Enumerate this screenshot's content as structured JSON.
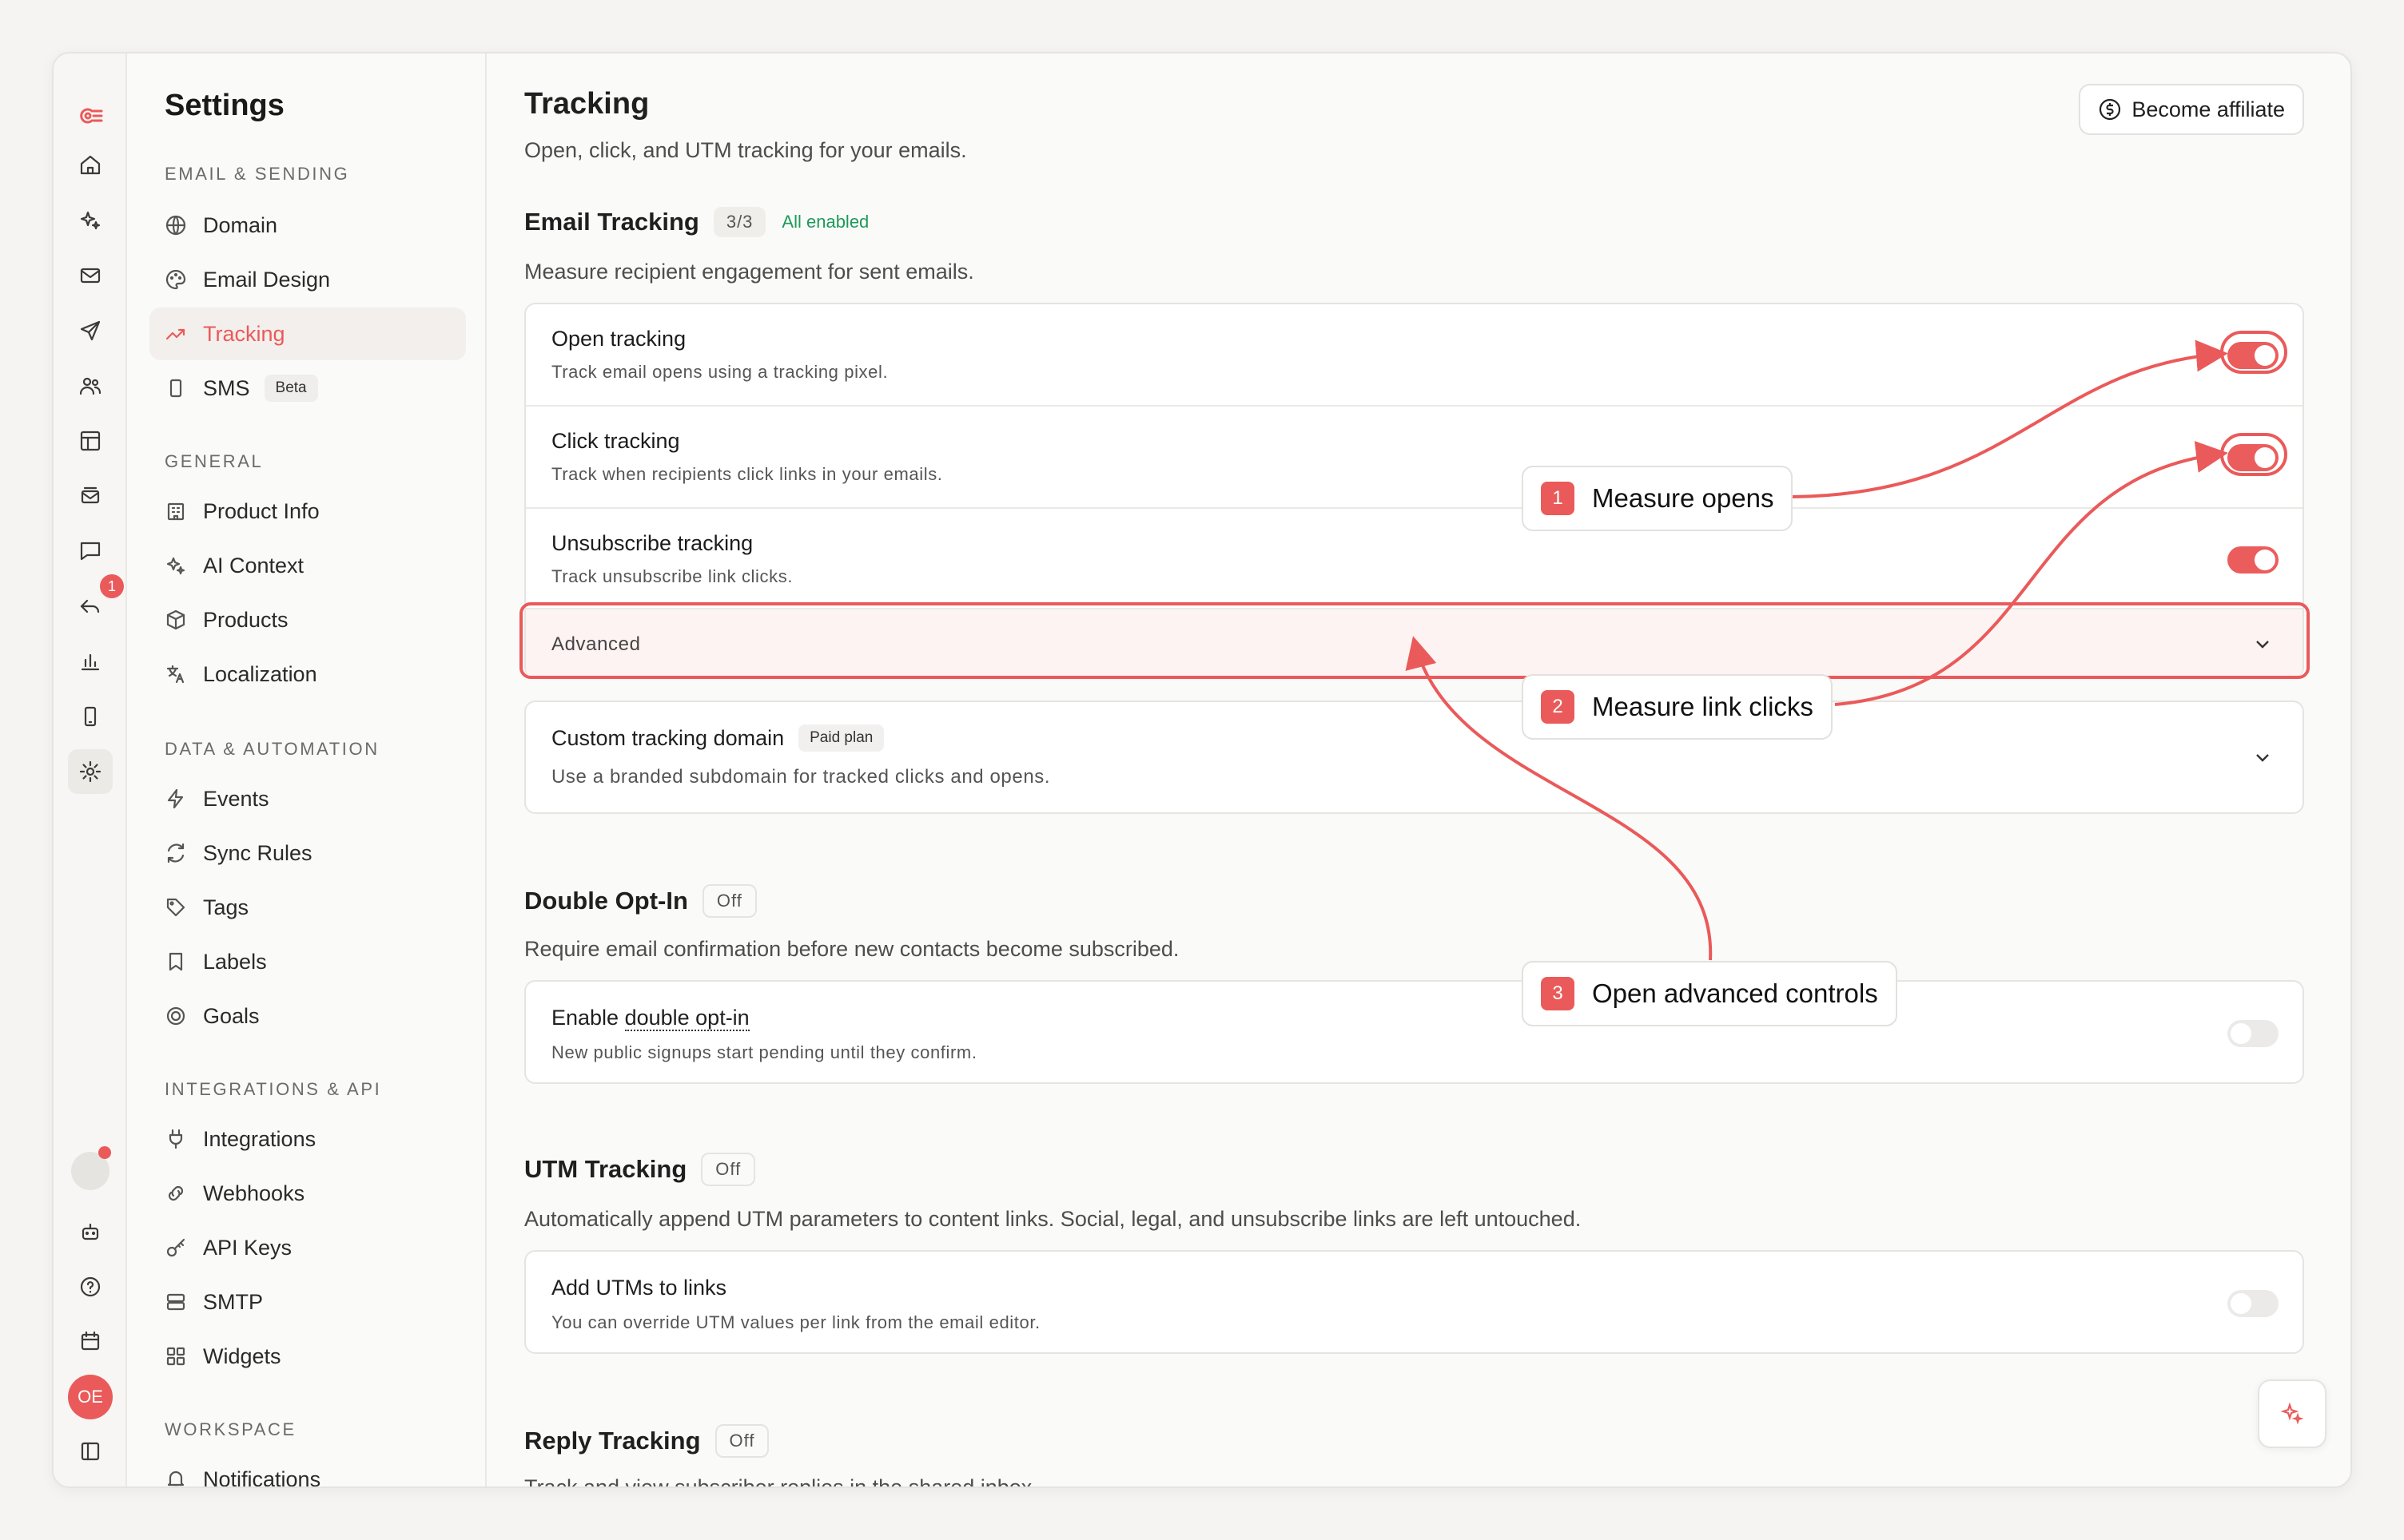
{
  "sidebar": {
    "title": "Settings",
    "sections": [
      {
        "label": "EMAIL & SENDING",
        "items": [
          {
            "label": "Domain",
            "icon": "globe-icon"
          },
          {
            "label": "Email Design",
            "icon": "palette-icon"
          },
          {
            "label": "Tracking",
            "icon": "trending-up-icon",
            "active": true
          },
          {
            "label": "SMS",
            "icon": "phone-icon",
            "badge": "Beta"
          }
        ]
      },
      {
        "label": "GENERAL",
        "items": [
          {
            "label": "Product Info",
            "icon": "building-icon"
          },
          {
            "label": "AI Context",
            "icon": "sparkles-icon"
          },
          {
            "label": "Products",
            "icon": "package-icon"
          },
          {
            "label": "Localization",
            "icon": "translate-icon"
          }
        ]
      },
      {
        "label": "DATA & AUTOMATION",
        "items": [
          {
            "label": "Events",
            "icon": "bolt-icon"
          },
          {
            "label": "Sync Rules",
            "icon": "refresh-icon"
          },
          {
            "label": "Tags",
            "icon": "tag-icon"
          },
          {
            "label": "Labels",
            "icon": "bookmark-icon"
          },
          {
            "label": "Goals",
            "icon": "target-icon"
          }
        ]
      },
      {
        "label": "INTEGRATIONS & API",
        "items": [
          {
            "label": "Integrations",
            "icon": "plug-icon"
          },
          {
            "label": "Webhooks",
            "icon": "link-icon"
          },
          {
            "label": "API Keys",
            "icon": "key-icon"
          },
          {
            "label": "SMTP",
            "icon": "server-icon"
          },
          {
            "label": "Widgets",
            "icon": "grid-icon"
          }
        ]
      },
      {
        "label": "WORKSPACE",
        "items": [
          {
            "label": "Notifications",
            "icon": "bell-icon"
          }
        ]
      }
    ]
  },
  "rail": {
    "inbox_badge": "1",
    "avatar_initials": "OE"
  },
  "header": {
    "title": "Tracking",
    "subtitle": "Open, click, and UTM tracking for your emails.",
    "affiliate_label": "Become affiliate"
  },
  "email_tracking": {
    "title": "Email Tracking",
    "count": "3/3",
    "status": "All enabled",
    "description": "Measure recipient engagement for sent emails.",
    "rows": [
      {
        "title": "Open tracking",
        "desc": "Track email opens using a tracking pixel.",
        "enabled": true
      },
      {
        "title": "Click tracking",
        "desc": "Track when recipients click links in your emails.",
        "enabled": true
      },
      {
        "title": "Unsubscribe tracking",
        "desc": "Track unsubscribe link clicks.",
        "enabled": true
      }
    ],
    "advanced_label": "Advanced"
  },
  "custom_domain": {
    "title": "Custom tracking domain",
    "badge": "Paid plan",
    "desc": "Use a branded subdomain for tracked clicks and opens."
  },
  "double_optin": {
    "title": "Double Opt-In",
    "status": "Off",
    "description": "Require email confirmation before new contacts become subscribed.",
    "row_title_prefix": "Enable ",
    "row_title_link": "double opt-in",
    "row_desc": "New public signups start pending until they confirm.",
    "enabled": false
  },
  "utm": {
    "title": "UTM Tracking",
    "status": "Off",
    "description": "Automatically append UTM parameters to content links. Social, legal, and unsubscribe links are left untouched.",
    "row_title": "Add UTMs to links",
    "row_desc": "You can override UTM values per link from the email editor.",
    "enabled": false
  },
  "reply": {
    "title": "Reply Tracking",
    "status": "Off",
    "description": "Track and view subscriber replies in the shared inbox."
  },
  "callouts": [
    {
      "num": "1",
      "label": "Measure opens"
    },
    {
      "num": "2",
      "label": "Measure link clicks"
    },
    {
      "num": "3",
      "label": "Open advanced controls"
    }
  ],
  "colors": {
    "accent": "#ea5a5a",
    "success": "#1e9a5a"
  }
}
